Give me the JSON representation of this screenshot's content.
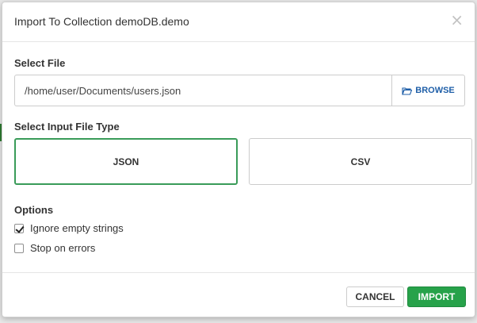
{
  "dialog": {
    "title": "Import To Collection demoDB.demo",
    "close_symbol": "×"
  },
  "file": {
    "section_label": "Select File",
    "path_value": "/home/user/Documents/users.json",
    "browse_label": "BROWSE",
    "browse_icon": "folder-open-icon"
  },
  "file_type": {
    "section_label": "Select Input File Type",
    "options": [
      {
        "label": "JSON",
        "selected": true
      },
      {
        "label": "CSV",
        "selected": false
      }
    ]
  },
  "options": {
    "section_label": "Options",
    "items": [
      {
        "label": "Ignore empty strings",
        "checked": true
      },
      {
        "label": "Stop on errors",
        "checked": false
      }
    ]
  },
  "footer": {
    "cancel_label": "CANCEL",
    "import_label": "IMPORT"
  },
  "colors": {
    "accent_green": "#27a24a",
    "link_blue": "#1f5fa8",
    "selected_border": "#3a9b59"
  }
}
